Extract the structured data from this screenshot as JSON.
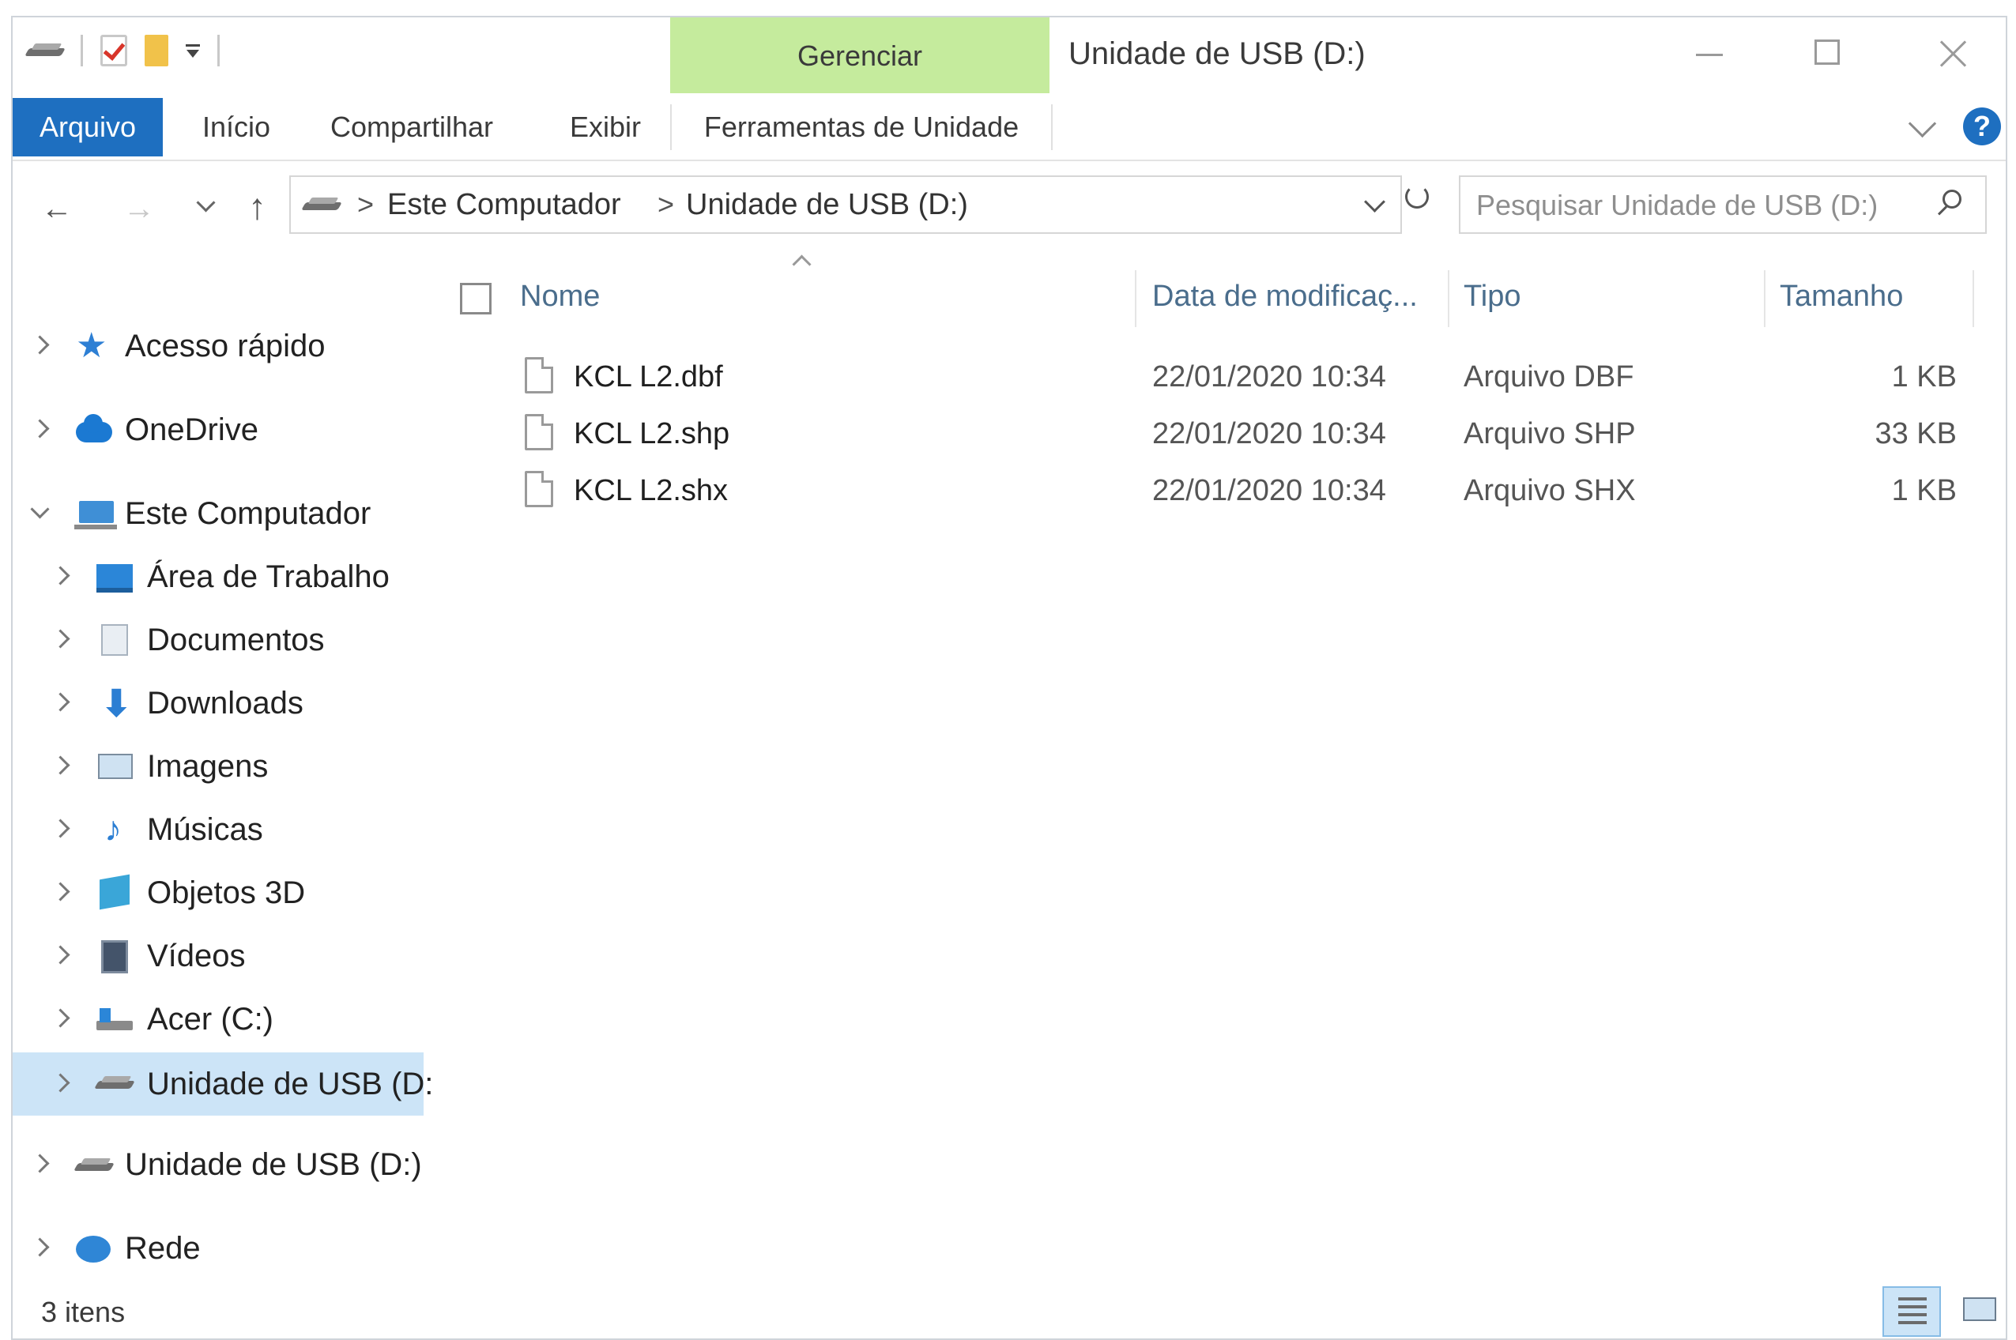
{
  "window": {
    "title": "Unidade de USB (D:)",
    "contextual_tab": "Gerenciar"
  },
  "ribbon": {
    "tabs": [
      "Arquivo",
      "Início",
      "Compartilhar",
      "Exibir",
      "Ferramentas de Unidade"
    ]
  },
  "address": {
    "crumbs": [
      "Este Computador",
      "Unidade de USB (D:)"
    ],
    "separator": ">"
  },
  "search": {
    "placeholder": "Pesquisar Unidade de USB (D:)"
  },
  "nav": {
    "items": [
      {
        "label": "Acesso rápido",
        "icon": "star-icon"
      },
      {
        "label": "OneDrive",
        "icon": "cloud-icon"
      },
      {
        "label": "Este Computador",
        "icon": "computer-icon"
      },
      {
        "label": "Área de Trabalho",
        "icon": "desktop-icon"
      },
      {
        "label": "Documentos",
        "icon": "documents-icon"
      },
      {
        "label": "Downloads",
        "icon": "download-icon"
      },
      {
        "label": "Imagens",
        "icon": "images-icon"
      },
      {
        "label": "Músicas",
        "icon": "music-icon"
      },
      {
        "label": "Objetos 3D",
        "icon": "3d-objects-icon"
      },
      {
        "label": "Vídeos",
        "icon": "video-icon"
      },
      {
        "label": "Acer (C:)",
        "icon": "disk-icon"
      },
      {
        "label": "Unidade de USB (D:",
        "icon": "usb-drive-icon"
      },
      {
        "label": "Unidade de USB (D:)",
        "icon": "usb-drive-icon"
      },
      {
        "label": "Rede",
        "icon": "network-icon"
      }
    ]
  },
  "columns": {
    "name": "Nome",
    "date": "Data de modificaç...",
    "type": "Tipo",
    "size": "Tamanho"
  },
  "files": [
    {
      "name": "KCL L2.dbf",
      "date": "22/01/2020 10:34",
      "type": "Arquivo DBF",
      "size": "1 KB"
    },
    {
      "name": "KCL L2.shp",
      "date": "22/01/2020 10:34",
      "type": "Arquivo SHP",
      "size": "33 KB"
    },
    {
      "name": "KCL L2.shx",
      "date": "22/01/2020 10:34",
      "type": "Arquivo SHX",
      "size": "1 KB"
    }
  ],
  "status": {
    "count": "3 itens"
  },
  "colors": {
    "file_tab": "#1e6fc0",
    "manage_tab": "#c5eb9d",
    "selection": "#cce4f7"
  }
}
